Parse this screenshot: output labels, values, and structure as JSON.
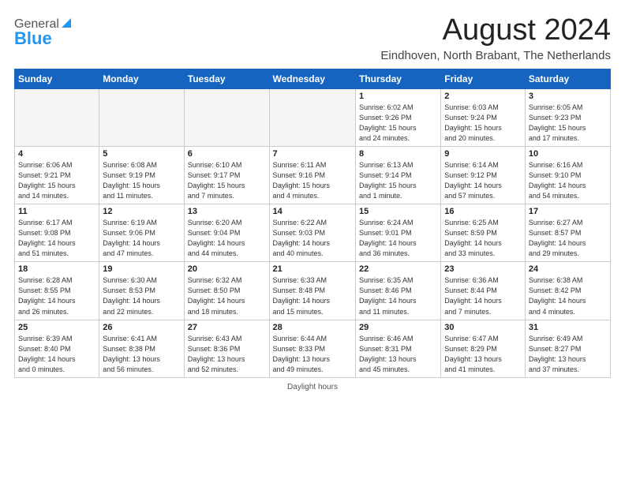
{
  "header": {
    "logo_general": "General",
    "logo_blue": "Blue",
    "month": "August 2024",
    "location": "Eindhoven, North Brabant, The Netherlands"
  },
  "weekdays": [
    "Sunday",
    "Monday",
    "Tuesday",
    "Wednesday",
    "Thursday",
    "Friday",
    "Saturday"
  ],
  "footer": "Daylight hours",
  "weeks": [
    [
      {
        "day": "",
        "info": ""
      },
      {
        "day": "",
        "info": ""
      },
      {
        "day": "",
        "info": ""
      },
      {
        "day": "",
        "info": ""
      },
      {
        "day": "1",
        "info": "Sunrise: 6:02 AM\nSunset: 9:26 PM\nDaylight: 15 hours\nand 24 minutes."
      },
      {
        "day": "2",
        "info": "Sunrise: 6:03 AM\nSunset: 9:24 PM\nDaylight: 15 hours\nand 20 minutes."
      },
      {
        "day": "3",
        "info": "Sunrise: 6:05 AM\nSunset: 9:23 PM\nDaylight: 15 hours\nand 17 minutes."
      }
    ],
    [
      {
        "day": "4",
        "info": "Sunrise: 6:06 AM\nSunset: 9:21 PM\nDaylight: 15 hours\nand 14 minutes."
      },
      {
        "day": "5",
        "info": "Sunrise: 6:08 AM\nSunset: 9:19 PM\nDaylight: 15 hours\nand 11 minutes."
      },
      {
        "day": "6",
        "info": "Sunrise: 6:10 AM\nSunset: 9:17 PM\nDaylight: 15 hours\nand 7 minutes."
      },
      {
        "day": "7",
        "info": "Sunrise: 6:11 AM\nSunset: 9:16 PM\nDaylight: 15 hours\nand 4 minutes."
      },
      {
        "day": "8",
        "info": "Sunrise: 6:13 AM\nSunset: 9:14 PM\nDaylight: 15 hours\nand 1 minute."
      },
      {
        "day": "9",
        "info": "Sunrise: 6:14 AM\nSunset: 9:12 PM\nDaylight: 14 hours\nand 57 minutes."
      },
      {
        "day": "10",
        "info": "Sunrise: 6:16 AM\nSunset: 9:10 PM\nDaylight: 14 hours\nand 54 minutes."
      }
    ],
    [
      {
        "day": "11",
        "info": "Sunrise: 6:17 AM\nSunset: 9:08 PM\nDaylight: 14 hours\nand 51 minutes."
      },
      {
        "day": "12",
        "info": "Sunrise: 6:19 AM\nSunset: 9:06 PM\nDaylight: 14 hours\nand 47 minutes."
      },
      {
        "day": "13",
        "info": "Sunrise: 6:20 AM\nSunset: 9:04 PM\nDaylight: 14 hours\nand 44 minutes."
      },
      {
        "day": "14",
        "info": "Sunrise: 6:22 AM\nSunset: 9:03 PM\nDaylight: 14 hours\nand 40 minutes."
      },
      {
        "day": "15",
        "info": "Sunrise: 6:24 AM\nSunset: 9:01 PM\nDaylight: 14 hours\nand 36 minutes."
      },
      {
        "day": "16",
        "info": "Sunrise: 6:25 AM\nSunset: 8:59 PM\nDaylight: 14 hours\nand 33 minutes."
      },
      {
        "day": "17",
        "info": "Sunrise: 6:27 AM\nSunset: 8:57 PM\nDaylight: 14 hours\nand 29 minutes."
      }
    ],
    [
      {
        "day": "18",
        "info": "Sunrise: 6:28 AM\nSunset: 8:55 PM\nDaylight: 14 hours\nand 26 minutes."
      },
      {
        "day": "19",
        "info": "Sunrise: 6:30 AM\nSunset: 8:53 PM\nDaylight: 14 hours\nand 22 minutes."
      },
      {
        "day": "20",
        "info": "Sunrise: 6:32 AM\nSunset: 8:50 PM\nDaylight: 14 hours\nand 18 minutes."
      },
      {
        "day": "21",
        "info": "Sunrise: 6:33 AM\nSunset: 8:48 PM\nDaylight: 14 hours\nand 15 minutes."
      },
      {
        "day": "22",
        "info": "Sunrise: 6:35 AM\nSunset: 8:46 PM\nDaylight: 14 hours\nand 11 minutes."
      },
      {
        "day": "23",
        "info": "Sunrise: 6:36 AM\nSunset: 8:44 PM\nDaylight: 14 hours\nand 7 minutes."
      },
      {
        "day": "24",
        "info": "Sunrise: 6:38 AM\nSunset: 8:42 PM\nDaylight: 14 hours\nand 4 minutes."
      }
    ],
    [
      {
        "day": "25",
        "info": "Sunrise: 6:39 AM\nSunset: 8:40 PM\nDaylight: 14 hours\nand 0 minutes."
      },
      {
        "day": "26",
        "info": "Sunrise: 6:41 AM\nSunset: 8:38 PM\nDaylight: 13 hours\nand 56 minutes."
      },
      {
        "day": "27",
        "info": "Sunrise: 6:43 AM\nSunset: 8:36 PM\nDaylight: 13 hours\nand 52 minutes."
      },
      {
        "day": "28",
        "info": "Sunrise: 6:44 AM\nSunset: 8:33 PM\nDaylight: 13 hours\nand 49 minutes."
      },
      {
        "day": "29",
        "info": "Sunrise: 6:46 AM\nSunset: 8:31 PM\nDaylight: 13 hours\nand 45 minutes."
      },
      {
        "day": "30",
        "info": "Sunrise: 6:47 AM\nSunset: 8:29 PM\nDaylight: 13 hours\nand 41 minutes."
      },
      {
        "day": "31",
        "info": "Sunrise: 6:49 AM\nSunset: 8:27 PM\nDaylight: 13 hours\nand 37 minutes."
      }
    ]
  ]
}
